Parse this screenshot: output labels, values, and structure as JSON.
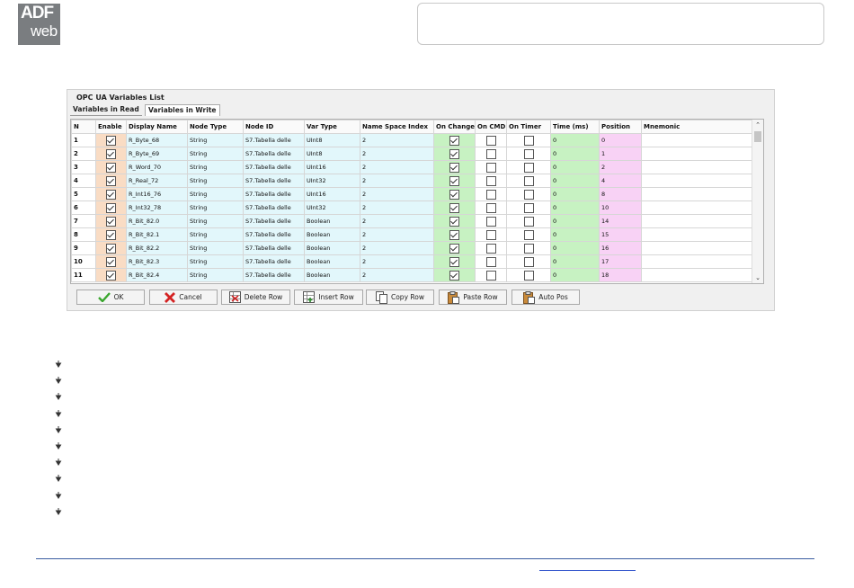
{
  "logo": {
    "line1": "ADF",
    "line2": "web"
  },
  "window": {
    "title": "OPC UA Variables List",
    "tabs": [
      "Variables in Read",
      "Variables in Write"
    ],
    "columns": [
      "N",
      "Enable",
      "Display Name",
      "Node Type",
      "Node ID",
      "Var Type",
      "Name Space Index",
      "On Change",
      "On CMD",
      "On Timer",
      "Time (ms)",
      "Position",
      "Mnemonic"
    ],
    "rows": [
      {
        "n": "1",
        "name": "R_Byte_68",
        "node_type": "String",
        "node_id": "S7.Tabella delle",
        "var_type": "UInt8",
        "ns": "2",
        "time": "0",
        "pos": "0"
      },
      {
        "n": "2",
        "name": "R_Byte_69",
        "node_type": "String",
        "node_id": "S7.Tabella delle",
        "var_type": "UInt8",
        "ns": "2",
        "time": "0",
        "pos": "1"
      },
      {
        "n": "3",
        "name": "R_Word_70",
        "node_type": "String",
        "node_id": "S7.Tabella delle",
        "var_type": "UInt16",
        "ns": "2",
        "time": "0",
        "pos": "2"
      },
      {
        "n": "4",
        "name": "R_Real_72",
        "node_type": "String",
        "node_id": "S7.Tabella delle",
        "var_type": "UInt32",
        "ns": "2",
        "time": "0",
        "pos": "4"
      },
      {
        "n": "5",
        "name": "R_Int16_76",
        "node_type": "String",
        "node_id": "S7.Tabella delle",
        "var_type": "UInt16",
        "ns": "2",
        "time": "0",
        "pos": "8"
      },
      {
        "n": "6",
        "name": "R_Int32_78",
        "node_type": "String",
        "node_id": "S7.Tabella delle",
        "var_type": "UInt32",
        "ns": "2",
        "time": "0",
        "pos": "10"
      },
      {
        "n": "7",
        "name": "R_Bit_82.0",
        "node_type": "String",
        "node_id": "S7.Tabella delle",
        "var_type": "Boolean",
        "ns": "2",
        "time": "0",
        "pos": "14"
      },
      {
        "n": "8",
        "name": "R_Bit_82.1",
        "node_type": "String",
        "node_id": "S7.Tabella delle",
        "var_type": "Boolean",
        "ns": "2",
        "time": "0",
        "pos": "15"
      },
      {
        "n": "9",
        "name": "R_Bit_82.2",
        "node_type": "String",
        "node_id": "S7.Tabella delle",
        "var_type": "Boolean",
        "ns": "2",
        "time": "0",
        "pos": "16"
      },
      {
        "n": "10",
        "name": "R_Bit_82.3",
        "node_type": "String",
        "node_id": "S7.Tabella delle",
        "var_type": "Boolean",
        "ns": "2",
        "time": "0",
        "pos": "17"
      },
      {
        "n": "11",
        "name": "R_Bit_82.4",
        "node_type": "String",
        "node_id": "S7.Tabella delle",
        "var_type": "Boolean",
        "ns": "2",
        "time": "0",
        "pos": "18"
      }
    ],
    "buttons": [
      {
        "label": "OK",
        "icon": "check-icon"
      },
      {
        "label": "Cancel",
        "icon": "close-icon"
      },
      {
        "label": "Delete Row",
        "icon": "delete-row-icon"
      },
      {
        "label": "Insert Row",
        "icon": "insert-row-icon"
      },
      {
        "label": "Copy Row",
        "icon": "copy-icon"
      },
      {
        "label": "Paste Row",
        "icon": "paste-icon"
      },
      {
        "label": "Auto Pos",
        "icon": "auto-pos-icon"
      }
    ]
  },
  "colors": {
    "enable_col": "#f9dcc4",
    "cyan_cols": "#e2f7fb",
    "green_cols": "#c7f2c2",
    "position_col": "#f8d2f5"
  }
}
